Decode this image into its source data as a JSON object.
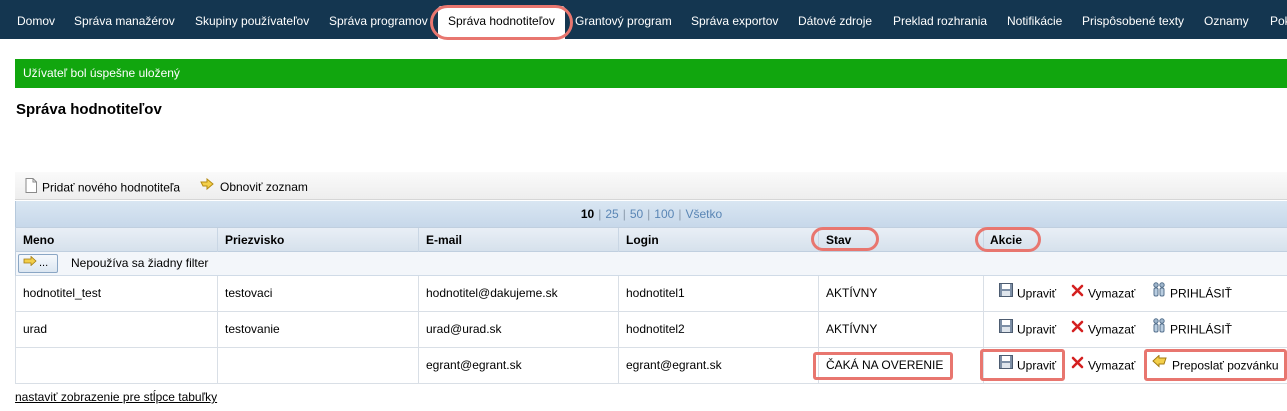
{
  "nav": {
    "items": [
      {
        "label": "Domov"
      },
      {
        "label": "Správa manažérov"
      },
      {
        "label": "Skupiny používateľov"
      },
      {
        "label": "Správa programov"
      },
      {
        "label": "Správa hodnotiteľov"
      },
      {
        "label": "Grantový program"
      },
      {
        "label": "Správa exportov"
      },
      {
        "label": "Dátové zdroje"
      },
      {
        "label": "Preklad rozhrania"
      },
      {
        "label": "Notifikácie"
      },
      {
        "label": "Prispôsobené texty"
      },
      {
        "label": "Oznamy"
      },
      {
        "label": "Pok"
      }
    ],
    "active_index": 4
  },
  "banner": {
    "text": "Užívateľ bol úspešne uložený"
  },
  "page": {
    "title": "Správa hodnotiteľov"
  },
  "toolbar": {
    "add_label": "Pridať nového hodnotiteľa",
    "refresh_label": "Obnoviť zoznam"
  },
  "pager": {
    "sizes": [
      "10",
      "25",
      "50",
      "100",
      "Všetko"
    ],
    "current": "10"
  },
  "table": {
    "columns": [
      "Meno",
      "Priezvisko",
      "E-mail",
      "Login",
      "Stav",
      "Akcie"
    ],
    "filter_button": "...",
    "filter_text": "Nepoužíva sa žiadny filter",
    "rows": [
      {
        "meno": "hodnotitel_test",
        "priezvisko": "testovaci",
        "email": "hodnotitel@dakujeme.sk",
        "login": "hodnotitel1",
        "stav": "AKTÍVNY",
        "edit": "Upraviť",
        "delete": "Vymazať",
        "third": "PRIHLÁSIŤ"
      },
      {
        "meno": "urad",
        "priezvisko": "testovanie",
        "email": "urad@urad.sk",
        "login": "hodnotitel2",
        "stav": "AKTÍVNY",
        "edit": "Upraviť",
        "delete": "Vymazať",
        "third": "PRIHLÁSIŤ"
      },
      {
        "meno": "",
        "priezvisko": "",
        "email": "egrant@egrant.sk",
        "login": "egrant@egrant.sk",
        "stav": "ČAKÁ NA OVERENIE",
        "edit": "Upraviť",
        "delete": "Vymazať",
        "third": "Preposlať pozvánku"
      }
    ]
  },
  "footer": {
    "columns_link": "nastaviť zobrazenie pre stĺpce tabuľky"
  },
  "colors": {
    "nav_bg": "#143650",
    "banner_bg": "#11a60e",
    "highlight": "#e8766f"
  },
  "icons": {
    "add": "document-icon",
    "refresh": "arrow-refresh-icon",
    "filter": "filter-arrow-icon",
    "edit": "floppy-disk-icon",
    "delete": "red-x-icon",
    "login": "users-icon",
    "resend": "yellow-arrow-icon"
  }
}
